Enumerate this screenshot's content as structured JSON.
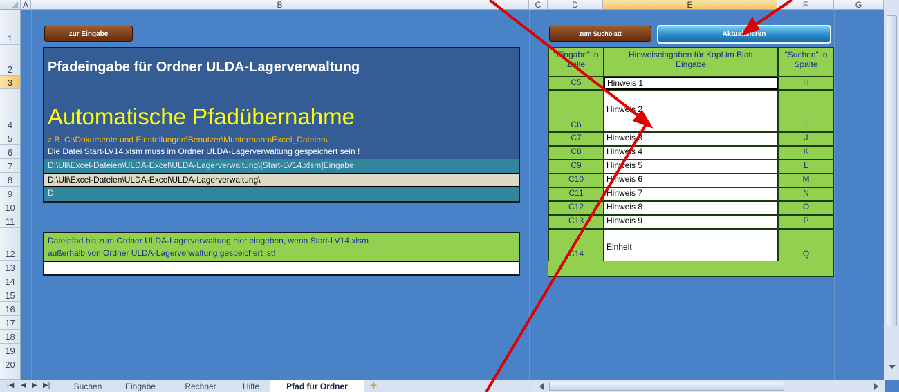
{
  "columns": [
    "A",
    "B",
    "C",
    "D",
    "E",
    "F",
    "G"
  ],
  "rows": [
    "1",
    "2",
    "3",
    "4",
    "5",
    "6",
    "7",
    "8",
    "9",
    "10",
    "11",
    "12",
    "13",
    "14",
    "15",
    "16",
    "17",
    "18",
    "19",
    "20"
  ],
  "buttons": {
    "zur_eingabe": "zur Eingabe",
    "zum_suchblatt": "zum Suchblatt",
    "aktualisieren": "Aktualisieren"
  },
  "panel": {
    "title": "Pfadeingabe für Ordner ULDA-Lagerverwaltung",
    "big_title": "Automatische Pfadübernahme",
    "example": "z.B.  C:\\Dokumente und Einstellungen\\Benutzer\\Mustermann\\Excel_Dateien\\",
    "note": "Die Datei Start-LV14.xlsm muss im Ordner ULDA-Lagerverwaltung gespeichert sein !",
    "path_full": "D:\\Uli\\Excel-Dateien\\ULDA-Excel\\ULDA-Lagerverwaltung\\[Start-LV14.xlsm]Eingabe",
    "path": "D:\\Uli\\Excel-Dateien\\ULDA-Excel\\ULDA-Lagerverwaltung\\",
    "drive": "D"
  },
  "manual": {
    "line1": "Dateipfad bis zum Ordner ULDA-Lagerverwaltung hier eingeben, wenn Start-LV14.xlsm",
    "line2": "außerhalb von Ordner ULDA-Lagerverwaltung gespeichert ist!",
    "input_value": ""
  },
  "table": {
    "head_d": "\"Eingabe\" in Zelle",
    "head_e": "Hinweiseingaben für Kopf im Blatt Eingabe",
    "head_f": "\"Suchen\" in Spalte",
    "rows": [
      {
        "cell": "C5",
        "hint": "Hinweis 1",
        "col": "H"
      },
      {
        "cell": "C6",
        "hint": "Hinweis 2",
        "col": "I"
      },
      {
        "cell": "C7",
        "hint": "Hinweis 3",
        "col": "J"
      },
      {
        "cell": "C8",
        "hint": "Hinweis 4",
        "col": "K"
      },
      {
        "cell": "C9",
        "hint": "Hinweis 5",
        "col": "L"
      },
      {
        "cell": "C10",
        "hint": "Hinweis 6",
        "col": "M"
      },
      {
        "cell": "C11",
        "hint": "Hinweis 7",
        "col": "N"
      },
      {
        "cell": "C12",
        "hint": "Hinweis 8",
        "col": "O"
      },
      {
        "cell": "C13",
        "hint": "Hinweis 9",
        "col": "P"
      },
      {
        "cell": "C14",
        "hint": "Einheit",
        "col": "Q"
      }
    ]
  },
  "tabs": [
    "Suchen",
    "Eingabe",
    "Rechner",
    "Hilfe",
    "Pfad für Ordner"
  ],
  "active_tab": "Pfad für Ordner",
  "colors": {
    "sheet_bg": "#4a82c8",
    "panel_bg": "#345c95",
    "green": "#92d050",
    "title_yellow": "#ffff00",
    "example_orange": "#ffc000"
  }
}
